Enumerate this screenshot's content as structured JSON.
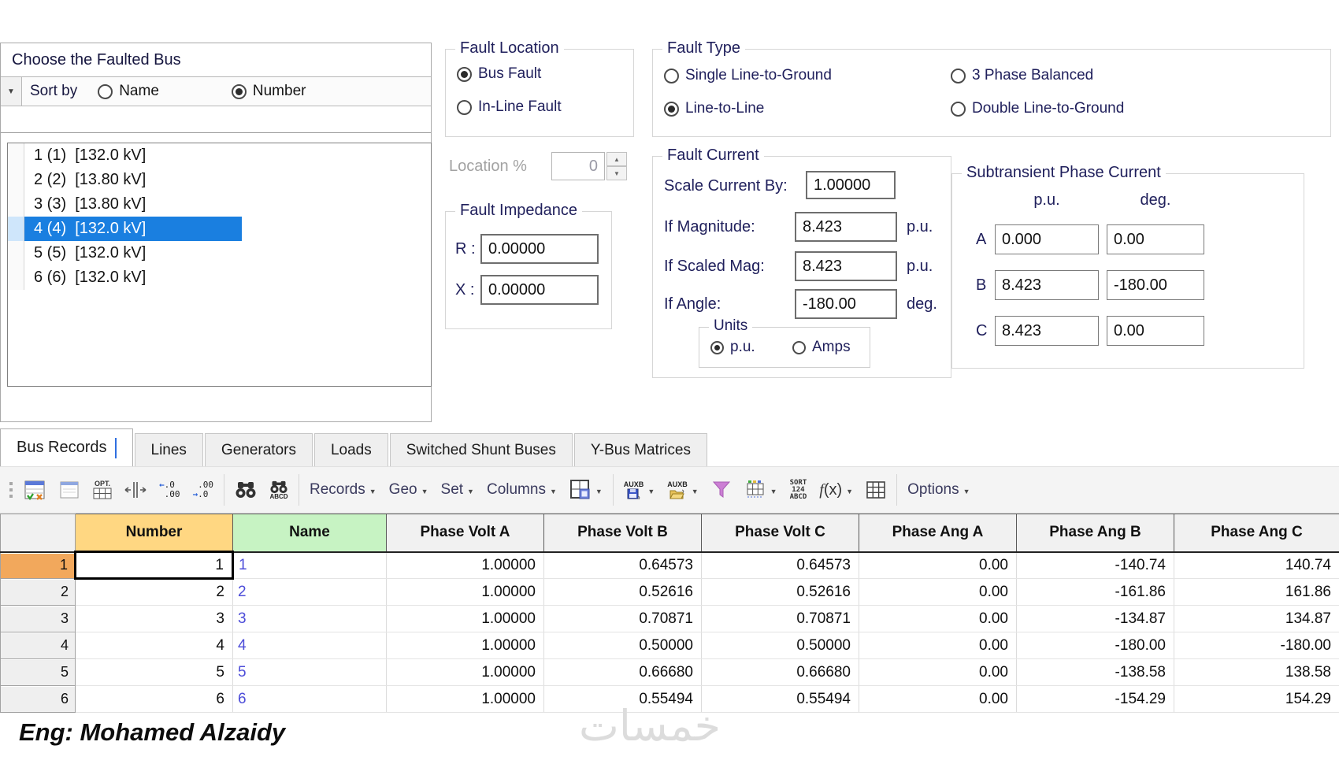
{
  "bus_panel": {
    "title": "Choose the Faulted Bus",
    "sort_label": "Sort by",
    "sort_options": [
      {
        "label": "Name",
        "selected": false
      },
      {
        "label": "Number",
        "selected": true
      }
    ],
    "filter_value": "",
    "buses": [
      {
        "label": "1 (1)  [132.0 kV]",
        "selected": false
      },
      {
        "label": "2 (2)  [13.80 kV]",
        "selected": false
      },
      {
        "label": "3 (3)  [13.80 kV]",
        "selected": false
      },
      {
        "label": "4 (4)  [132.0 kV]",
        "selected": true
      },
      {
        "label": "5 (5)  [132.0 kV]",
        "selected": false
      },
      {
        "label": "6 (6)  [132.0 kV]",
        "selected": false
      }
    ]
  },
  "fault_location": {
    "title": "Fault Location",
    "options": [
      {
        "label": "Bus Fault",
        "selected": true
      },
      {
        "label": "In-Line Fault",
        "selected": false
      }
    ],
    "location_percent": {
      "label": "Location %",
      "value": "0"
    }
  },
  "fault_impedance": {
    "title": "Fault Impedance",
    "r_label": "R :",
    "r_value": "0.00000",
    "x_label": "X :",
    "x_value": "0.00000"
  },
  "fault_type": {
    "title": "Fault Type",
    "options": [
      {
        "label": "Single Line-to-Ground",
        "selected": false
      },
      {
        "label": "Line-to-Line",
        "selected": true
      },
      {
        "label": "3 Phase Balanced",
        "selected": false
      },
      {
        "label": "Double Line-to-Ground",
        "selected": false
      }
    ]
  },
  "fault_current": {
    "title": "Fault Current",
    "scale_label": "Scale Current By:",
    "scale_value": "1.00000",
    "mag_label": "If Magnitude:",
    "mag_value": "8.423",
    "mag_unit": "p.u.",
    "scaled_label": "If Scaled Mag:",
    "scaled_value": "8.423",
    "scaled_unit": "p.u.",
    "angle_label": "If Angle:",
    "angle_value": "-180.00",
    "angle_unit": "deg.",
    "units": {
      "title": "Units",
      "options": [
        {
          "label": "p.u.",
          "selected": true
        },
        {
          "label": "Amps",
          "selected": false
        }
      ]
    }
  },
  "subtransient": {
    "title": "Subtransient Phase Current",
    "pu_header": "p.u.",
    "deg_header": "deg.",
    "rows": [
      {
        "phase": "A",
        "pu": "0.000",
        "deg": "0.00"
      },
      {
        "phase": "B",
        "pu": "8.423",
        "deg": "-180.00"
      },
      {
        "phase": "C",
        "pu": "8.423",
        "deg": "0.00"
      }
    ]
  },
  "tabs": [
    {
      "label": "Bus Records",
      "active": true
    },
    {
      "label": "Lines",
      "active": false
    },
    {
      "label": "Generators",
      "active": false
    },
    {
      "label": "Loads",
      "active": false
    },
    {
      "label": "Switched Shunt Buses",
      "active": false
    },
    {
      "label": "Y-Bus Matrices",
      "active": false
    }
  ],
  "toolbar": {
    "records_label": "Records",
    "geo_label": "Geo",
    "set_label": "Set",
    "columns_label": "Columns",
    "fx_label": "f(x)",
    "options_label": "Options",
    "opt_icon_text": "OPT.",
    "aux_save_text": "AUXB",
    "aux_open_text": "AUXB",
    "sort_icon_line1": "SORT",
    "sort_icon_line2": "124",
    "sort_icon_line3": "ABCD",
    "find_abcd_text": "ABCD",
    "inc_dec_top": ".0",
    "inc_dec_bottom": ".00",
    "dec_dec_top": ".00",
    "dec_dec_bottom": ".0"
  },
  "grid": {
    "columns": [
      "Number",
      "Name",
      "Phase Volt A",
      "Phase Volt B",
      "Phase Volt C",
      "Phase Ang A",
      "Phase Ang B",
      "Phase Ang C"
    ],
    "rows": [
      {
        "n": "1",
        "number": "1",
        "name": "1",
        "pva": "1.00000",
        "pvb": "0.64573",
        "pvc": "0.64573",
        "paa": "0.00",
        "pab": "-140.74",
        "pac": "140.74"
      },
      {
        "n": "2",
        "number": "2",
        "name": "2",
        "pva": "1.00000",
        "pvb": "0.52616",
        "pvc": "0.52616",
        "paa": "0.00",
        "pab": "-161.86",
        "pac": "161.86"
      },
      {
        "n": "3",
        "number": "3",
        "name": "3",
        "pva": "1.00000",
        "pvb": "0.70871",
        "pvc": "0.70871",
        "paa": "0.00",
        "pab": "-134.87",
        "pac": "134.87"
      },
      {
        "n": "4",
        "number": "4",
        "name": "4",
        "pva": "1.00000",
        "pvb": "0.50000",
        "pvc": "0.50000",
        "paa": "0.00",
        "pab": "-180.00",
        "pac": "-180.00"
      },
      {
        "n": "5",
        "number": "5",
        "name": "5",
        "pva": "1.00000",
        "pvb": "0.66680",
        "pvc": "0.66680",
        "paa": "0.00",
        "pab": "-138.58",
        "pac": "138.58"
      },
      {
        "n": "6",
        "number": "6",
        "name": "6",
        "pva": "1.00000",
        "pvb": "0.55494",
        "pvc": "0.55494",
        "paa": "0.00",
        "pab": "-154.29",
        "pac": "154.29"
      }
    ]
  },
  "credit": {
    "text": "Eng: Mohamed Alzaidy"
  },
  "watermark": {
    "text": "خمسات"
  },
  "colors": {
    "selection_blue": "#1a7fe0",
    "number_header": "#ffd782",
    "name_header": "#c7f3c3",
    "selected_row_header": "#f2a85c",
    "funnel_pink": "#cc7fd4",
    "label_navy": "#20205c",
    "name_text_blue": "#4d4dd9"
  }
}
